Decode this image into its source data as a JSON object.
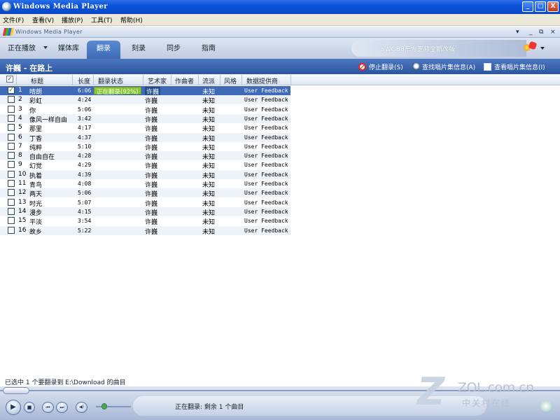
{
  "window": {
    "title": "Windows Media Player",
    "minimize": "_",
    "maximize": "□",
    "close": "X"
  },
  "menubar": [
    {
      "label": "文件(F)"
    },
    {
      "label": "查看(V)"
    },
    {
      "label": "播放(P)"
    },
    {
      "label": "工具(T)"
    },
    {
      "label": "帮助(H)"
    }
  ],
  "wmpbar": {
    "title": "Windows Media Player",
    "collapse": "▾",
    "restore": "⧉",
    "close": "×"
  },
  "tabs": [
    {
      "label": "正在播放",
      "active": false
    },
    {
      "label": "媒体库",
      "active": false
    },
    {
      "label": "翻录",
      "active": true
    },
    {
      "label": "刻录",
      "active": false
    },
    {
      "label": "同步",
      "active": false
    },
    {
      "label": "指南",
      "active": false
    }
  ],
  "promo": {
    "text": "SWGBB东方宽频全新改版"
  },
  "album": {
    "title": "许巍 - 在路上",
    "actions": [
      {
        "label": "停止翻录(S)",
        "icon": "stop-icon"
      },
      {
        "label": "查找唱片集信息(A)",
        "icon": "find-icon"
      },
      {
        "label": "查看唱片集信息(I)",
        "icon": "album-info-icon"
      }
    ]
  },
  "columns": [
    "标题",
    "长度",
    "翻录状态",
    "艺术家",
    "作曲者",
    "流派",
    "风格",
    "数据提供商"
  ],
  "tracks": [
    {
      "num": "1",
      "title": "晴朗",
      "length": "6:06",
      "rip_status": "正在翻录(92%)",
      "artist": "许巍",
      "genre": "未知",
      "provider": "User Feedback",
      "checked": true,
      "selected": true
    },
    {
      "num": "2",
      "title": "彩虹",
      "length": "4:24",
      "rip_status": "",
      "artist": "许巍",
      "genre": "未知",
      "provider": "User Feedback",
      "checked": false
    },
    {
      "num": "3",
      "title": "你",
      "length": "5:06",
      "rip_status": "",
      "artist": "许巍",
      "genre": "未知",
      "provider": "User Feedback",
      "checked": false
    },
    {
      "num": "4",
      "title": "像风一样自由",
      "length": "3:42",
      "rip_status": "",
      "artist": "许巍",
      "genre": "未知",
      "provider": "User Feedback",
      "checked": false
    },
    {
      "num": "5",
      "title": "那里",
      "length": "4:17",
      "rip_status": "",
      "artist": "许巍",
      "genre": "未知",
      "provider": "User Feedback",
      "checked": false
    },
    {
      "num": "6",
      "title": "丁香",
      "length": "4:37",
      "rip_status": "",
      "artist": "许巍",
      "genre": "未知",
      "provider": "User Feedback",
      "checked": false
    },
    {
      "num": "7",
      "title": "纯粹",
      "length": "5:10",
      "rip_status": "",
      "artist": "许巍",
      "genre": "未知",
      "provider": "User Feedback",
      "checked": false
    },
    {
      "num": "8",
      "title": "自由自在",
      "length": "4:28",
      "rip_status": "",
      "artist": "许巍",
      "genre": "未知",
      "provider": "User Feedback",
      "checked": false
    },
    {
      "num": "9",
      "title": "幻觉",
      "length": "4:29",
      "rip_status": "",
      "artist": "许巍",
      "genre": "未知",
      "provider": "User Feedback",
      "checked": false
    },
    {
      "num": "10",
      "title": "执着",
      "length": "4:39",
      "rip_status": "",
      "artist": "许巍",
      "genre": "未知",
      "provider": "User Feedback",
      "checked": false
    },
    {
      "num": "11",
      "title": "青鸟",
      "length": "4:08",
      "rip_status": "",
      "artist": "许巍",
      "genre": "未知",
      "provider": "User Feedback",
      "checked": false
    },
    {
      "num": "12",
      "title": "两天",
      "length": "5:06",
      "rip_status": "",
      "artist": "许巍",
      "genre": "未知",
      "provider": "User Feedback",
      "checked": false
    },
    {
      "num": "13",
      "title": "时光",
      "length": "5:07",
      "rip_status": "",
      "artist": "许巍",
      "genre": "未知",
      "provider": "User Feedback",
      "checked": false
    },
    {
      "num": "14",
      "title": "漫步",
      "length": "4:15",
      "rip_status": "",
      "artist": "许巍",
      "genre": "未知",
      "provider": "User Feedback",
      "checked": false
    },
    {
      "num": "15",
      "title": "平淡",
      "length": "3:54",
      "rip_status": "",
      "artist": "许巍",
      "genre": "未知",
      "provider": "User Feedback",
      "checked": false
    },
    {
      "num": "16",
      "title": "故乡",
      "length": "5:22",
      "rip_status": "",
      "artist": "许巍",
      "genre": "未知",
      "provider": "User Feedback",
      "checked": false
    }
  ],
  "status": {
    "text": "已选中 1 个要翻录到 E:\\Download 的曲目"
  },
  "transport": {
    "now_playing": "正在翻录: 剩余 1 个曲目",
    "play": "▶",
    "stop": "■",
    "prev": "⏮",
    "next": "⏭",
    "mute": "◀)"
  },
  "watermark": {
    "url": "ZOL.com.cn",
    "cn": "中关村在线"
  },
  "colors": {
    "title_bar": "#0a52d6",
    "album_bar": "#3e6ab7",
    "selected_row": "#3e6ab7",
    "progress": "#8cc63f"
  }
}
